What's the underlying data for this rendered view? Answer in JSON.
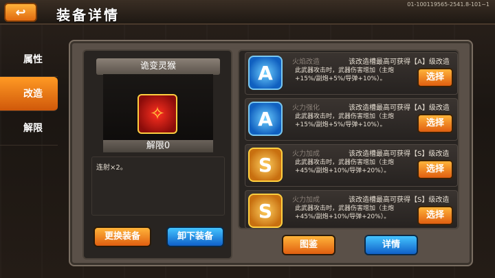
{
  "header": {
    "title": "装备详情",
    "back_icon": "back-arrow-icon",
    "version": "01-100119565-2541.8-101~1"
  },
  "sidebar": {
    "tabs": [
      {
        "label": "属性"
      },
      {
        "label": "改造",
        "active": true
      },
      {
        "label": "解限"
      }
    ]
  },
  "equipment": {
    "name": "诡变灵猴",
    "icon": "weapon-icon",
    "limit_label": "解限0",
    "description": "连射×2。"
  },
  "left_buttons": {
    "change": "更换装备",
    "unequip": "卸下装备"
  },
  "mods": [
    {
      "grade": "A",
      "name": "火焰改造",
      "grade_text": "该改造槽最高可获得【A】级改造",
      "desc": "此武器攻击时，武器伤害增加（主炮+15%/副炮+5%/导弹+10%）。",
      "button": "选择"
    },
    {
      "grade": "A",
      "name": "火力强化",
      "grade_text": "该改造槽最高可获得【A】级改造",
      "desc": "此武器攻击时，武器伤害增加（主炮+15%/副炮+5%/导弹+10%）。",
      "button": "选择"
    },
    {
      "grade": "S",
      "name": "火力加成",
      "grade_text": "该改造槽最高可获得【S】级改造",
      "desc": "此武器攻击时，武器伤害增加（主炮+45%/副炮+10%/导弹+20%）。",
      "button": "选择"
    },
    {
      "grade": "S",
      "name": "火力加成",
      "grade_text": "该改造槽最高可获得【S】级改造",
      "desc": "此武器攻击时，武器伤害增加（主炮+45%/副炮+10%/导弹+20%）。",
      "button": "选择"
    }
  ],
  "bottom_buttons": {
    "catalog": "图鉴",
    "details": "详情"
  }
}
